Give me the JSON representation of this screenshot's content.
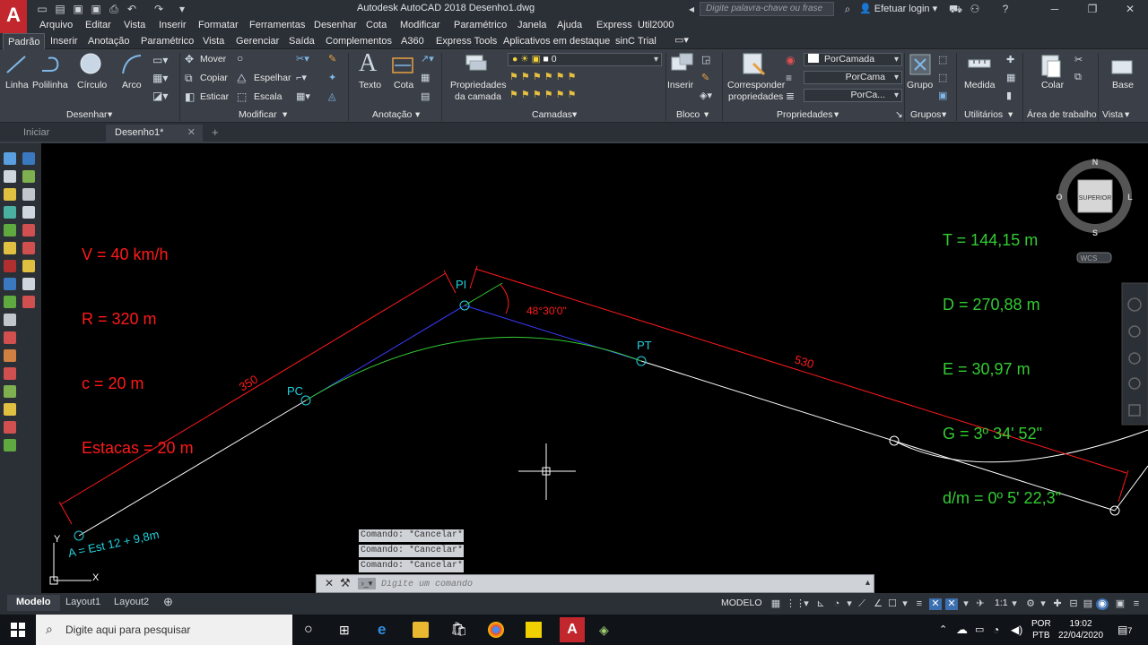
{
  "app": {
    "title": "Autodesk AutoCAD 2018    Desenho1.dwg",
    "logo": "A",
    "search_placeholder": "Digite palavra-chave ou frase",
    "login": "Efetuar login"
  },
  "menu": [
    "Arquivo",
    "Editar",
    "Vista",
    "Inserir",
    "Formatar",
    "Ferramentas",
    "Desenhar",
    "Cota",
    "Modificar",
    "Paramétrico",
    "Janela",
    "Ajuda",
    "Express",
    "Util2000"
  ],
  "ribbon_tabs": [
    "Padrão",
    "Inserir",
    "Anotação",
    "Paramétrico",
    "Vista",
    "Gerenciar",
    "Saída",
    "Complementos",
    "A360",
    "Express Tools",
    "Aplicativos em destaque",
    "sinC Trial"
  ],
  "ribbon": {
    "draw": {
      "linha": "Linha",
      "polilinha": "Polilinha",
      "circulo": "Círculo",
      "arco": "Arco",
      "title": "Desenhar"
    },
    "modify": {
      "mover": "Mover",
      "copiar": "Copiar",
      "esticar": "Esticar",
      "espelhar": "Espelhar",
      "escala": "Escala",
      "title": "Modificar"
    },
    "annotation": {
      "texto": "Texto",
      "cota": "Cota",
      "title": "Anotação"
    },
    "layers": {
      "props_1": "Propriedades",
      "props_2": "da camada",
      "layer_value": "0",
      "title": "Camadas"
    },
    "block": {
      "inserir": "Inserir",
      "title": "Bloco"
    },
    "properties": {
      "corresp_1": "Corresponder",
      "corresp_2": "propriedades",
      "color": "PorCamada",
      "linetype": "PorCama",
      "lineweight": "PorCa...",
      "title": "Propriedades"
    },
    "groups": {
      "grupo": "Grupo",
      "title": "Grupos"
    },
    "utilities": {
      "medida": "Medida",
      "title": "Utilitários"
    },
    "clipboard": {
      "colar": "Colar",
      "title": "Área de trabalho"
    },
    "view": {
      "base": "Base",
      "title": "Vista"
    }
  },
  "doc_tabs": {
    "start": "Iniciar",
    "current": "Desenho1*",
    "add": "+"
  },
  "drawing": {
    "params": [
      "V = 40 km/h",
      "R = 320 m",
      "c = 20 m",
      "Estacas = 20 m"
    ],
    "results": [
      "T = 144,15 m",
      "D = 270,88 m",
      "E = 30,97 m",
      "G = 3º 34' 52\"",
      "d/m = 0º 5' 22,3\""
    ],
    "labels": {
      "pi": "PI",
      "pc": "PC",
      "pt": "PT",
      "angle": "48°30'0\"",
      "dim_left": "350",
      "dim_right": "530",
      "point_a": "A = Est 12 + 9,8m"
    },
    "ucs": {
      "x": "X",
      "y": "Y"
    },
    "viewcube": {
      "n": "N",
      "s": "S",
      "o": "O",
      "l": "L",
      "face": "SUPERIOR",
      "wcs": "WCS"
    },
    "colors": {
      "red": "#ff1a1a",
      "cyan": "#21d0dc",
      "green": "#33cc33",
      "blue": "#3b3bff",
      "white": "#ffffff"
    }
  },
  "command": {
    "history": [
      "Comando: *Cancelar*",
      "Comando: *Cancelar*",
      "Comando: *Cancelar*"
    ],
    "placeholder": "Digite um comando"
  },
  "layout_tabs": [
    "Modelo",
    "Layout1",
    "Layout2"
  ],
  "status": {
    "mode": "MODELO",
    "scale": "1:1"
  },
  "taskbar": {
    "search": "Digite aqui para pesquisar",
    "lang_1": "POR",
    "lang_2": "PTB",
    "time": "19:02",
    "date": "22/04/2020",
    "notifications": "7"
  }
}
